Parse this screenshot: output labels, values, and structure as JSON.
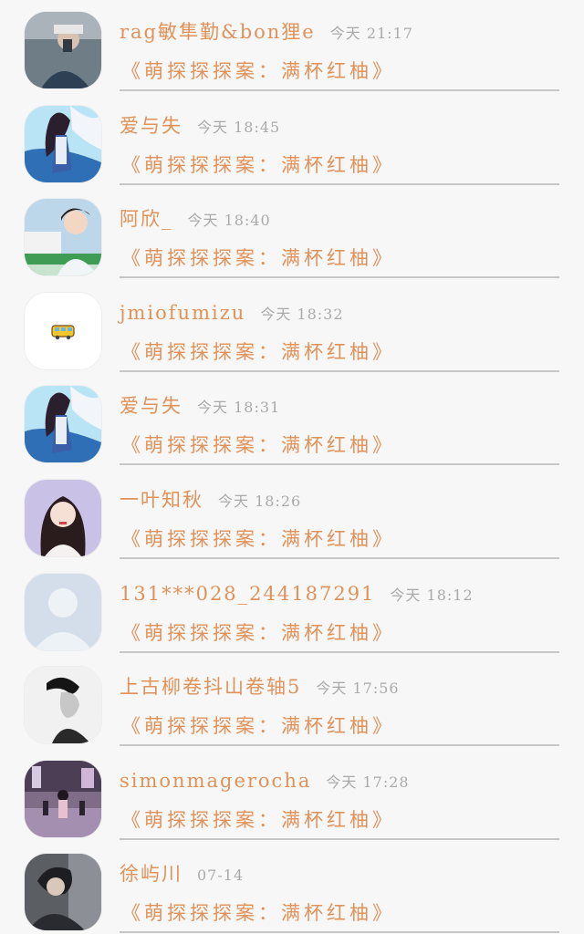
{
  "messages": [
    {
      "name": "rag敏隼勤&bon狸e",
      "time": "今天 21:17",
      "text": "《萌探探探案：满杯红柚》",
      "avatar": "person-mirror-selfie"
    },
    {
      "name": "爱与失",
      "time": "今天 18:45",
      "text": "《萌探探探案：满杯红柚》",
      "avatar": "anime-character"
    },
    {
      "name": "阿欣_",
      "time": "今天 18:40",
      "text": "《萌探探探案：满杯红柚》",
      "avatar": "young-man-outdoor"
    },
    {
      "name": "jmiofumizu",
      "time": "今天 18:32",
      "text": "《萌探探探案：满杯红柚》",
      "avatar": "yellow-bus-cartoon"
    },
    {
      "name": "爱与失",
      "time": "今天 18:31",
      "text": "《萌探探探案：满杯红柚》",
      "avatar": "anime-character"
    },
    {
      "name": "一叶知秋",
      "time": "今天 18:26",
      "text": "《萌探探探案：满杯红柚》",
      "avatar": "young-woman-portrait"
    },
    {
      "name": "131***028_244187291",
      "time": "今天 18:12",
      "text": "《萌探探探案：满杯红柚》",
      "avatar": "default-user-silhouette"
    },
    {
      "name": "上古柳卷抖山卷轴5",
      "time": "今天 17:56",
      "text": "《萌探探探案：满杯红柚》",
      "avatar": "man-profile-bw"
    },
    {
      "name": "simonmagerocha",
      "time": "今天 17:28",
      "text": "《萌探探探案：满杯红柚》",
      "avatar": "city-street-crowd"
    },
    {
      "name": "徐屿川",
      "time": "07-14",
      "text": "《萌探探探案：满杯红柚》",
      "avatar": "person-in-dark"
    }
  ]
}
